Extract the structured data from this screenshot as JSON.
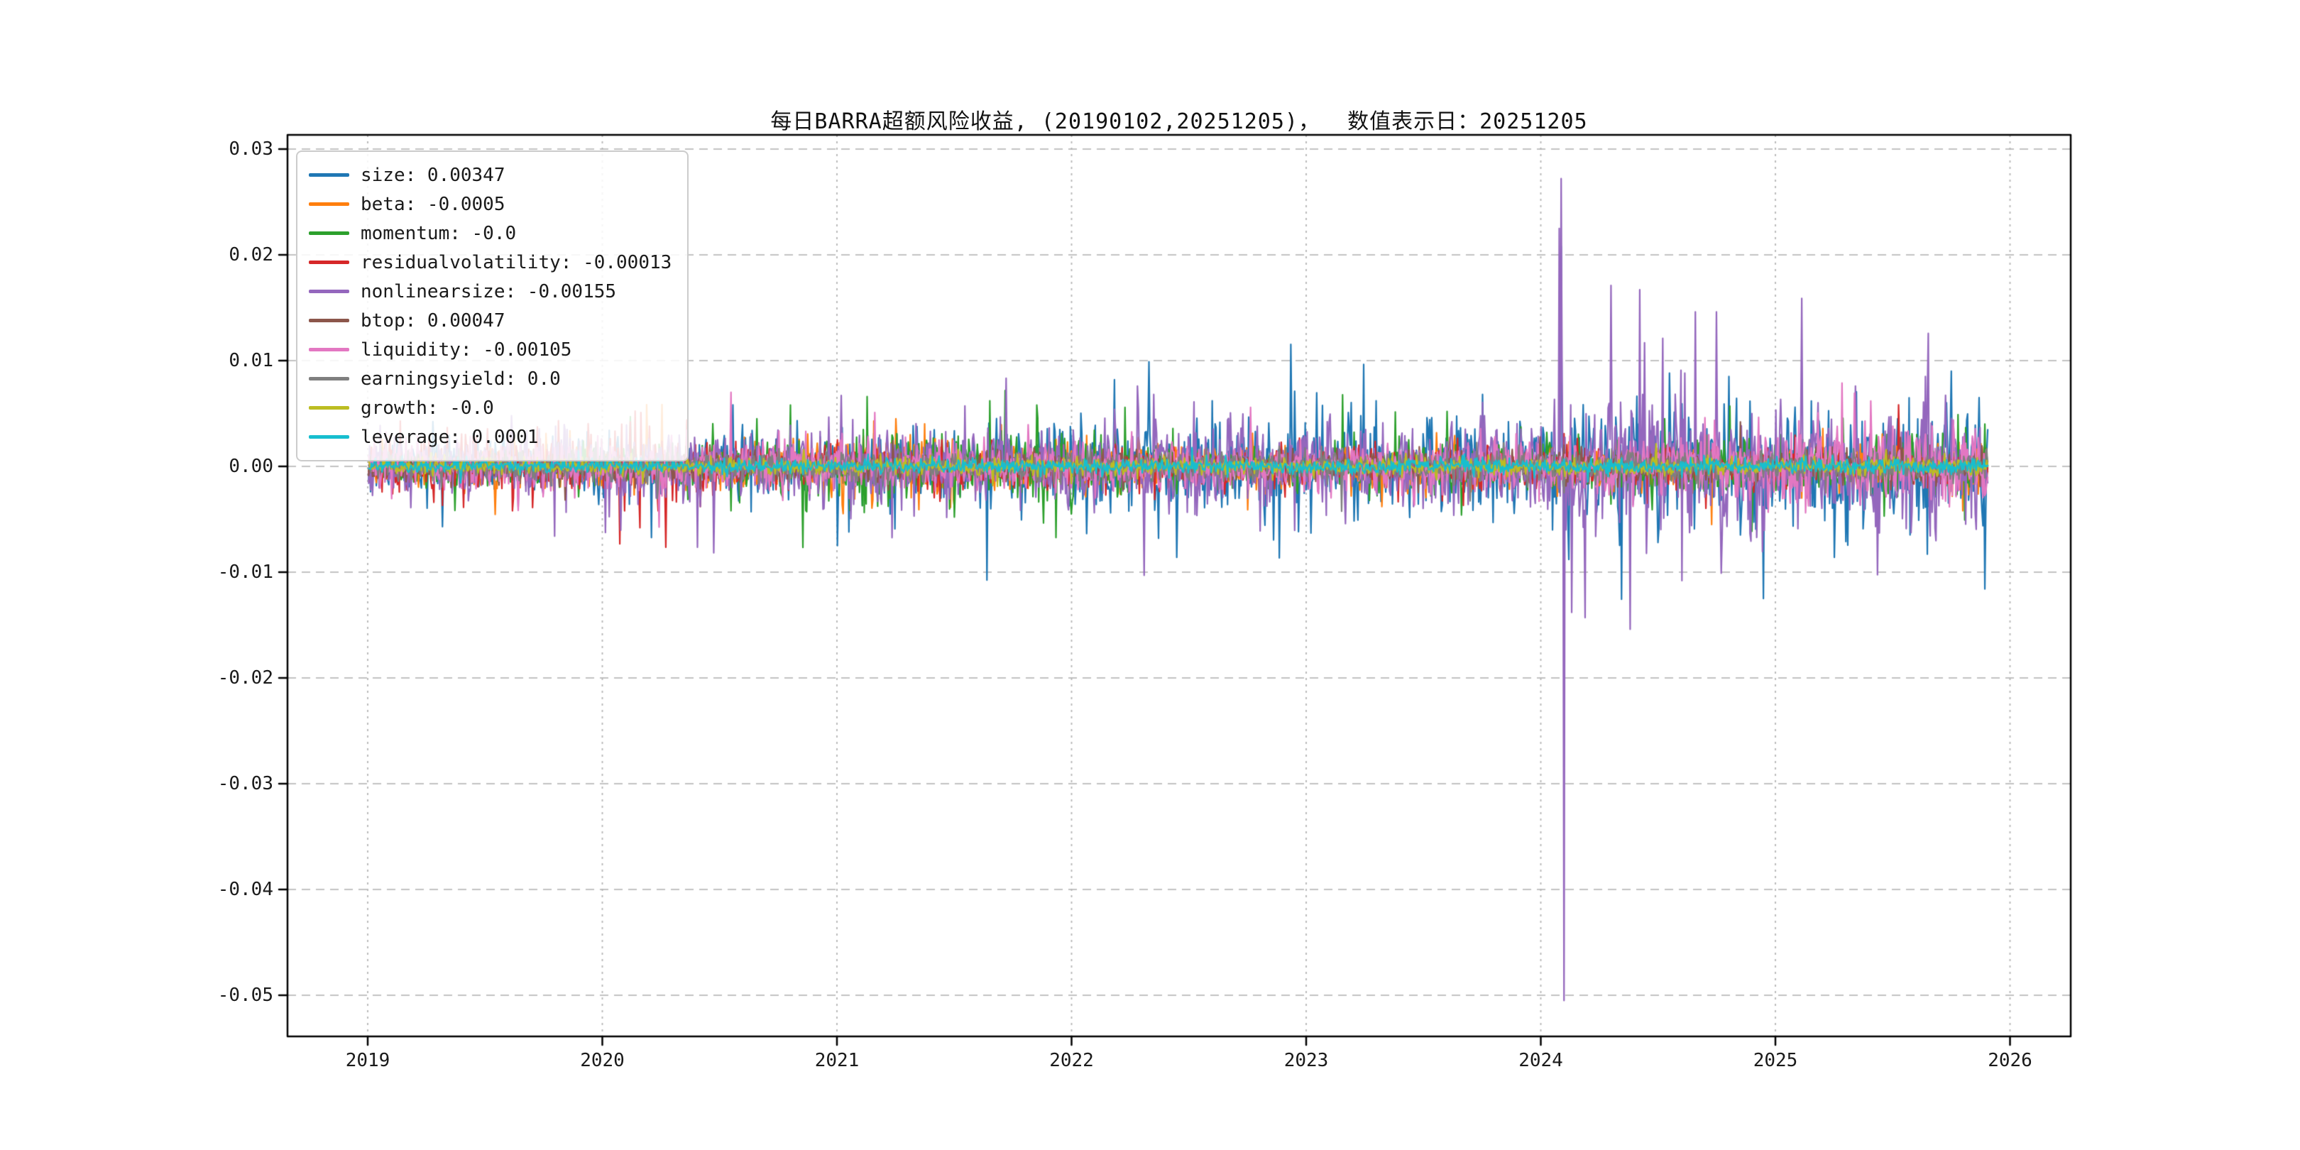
{
  "title": "每日BARRA超额风险收益, (20190102,20251205)，  数值表示日：20251205",
  "chart_data": {
    "type": "line",
    "title": "每日BARRA超额风险收益, (20190102,20251205)，  数值表示日：20251205",
    "date_range_start": "20190102",
    "date_range_end": "20251205",
    "value_label_date": "20251205",
    "xlabel": "",
    "ylabel": "",
    "x_range_years": [
      2019.0,
      2025.92
    ],
    "ylim": [
      -0.054,
      0.031
    ],
    "grid": true,
    "legend_position": "upper left",
    "x_tick_values": [
      2019,
      2020,
      2021,
      2022,
      2023,
      2024,
      2025,
      2026
    ],
    "x_tick_labels": [
      "2019",
      "2020",
      "2021",
      "2022",
      "2023",
      "2024",
      "2025",
      "2026"
    ],
    "y_tick_values": [
      0.03,
      0.02,
      0.01,
      0.0,
      -0.01,
      -0.02,
      -0.03,
      -0.04,
      -0.05
    ],
    "y_tick_labels": [
      "0.03",
      "0.02",
      "0.01",
      "0.00",
      "-0.01",
      "-0.02",
      "-0.03",
      "-0.04",
      "-0.05"
    ],
    "series": [
      {
        "name": "size",
        "legend_label": "size: 0.00347",
        "color": "#1f77b4",
        "last_value": 0.00347,
        "amp_keys": [
          [
            2019,
            0.0013
          ],
          [
            2020,
            0.0013
          ],
          [
            2021,
            0.0015
          ],
          [
            2021.5,
            0.0018
          ],
          [
            2022,
            0.002
          ],
          [
            2022.5,
            0.0022
          ],
          [
            2023,
            0.002
          ],
          [
            2024,
            0.0022
          ],
          [
            2024.3,
            0.0026
          ],
          [
            2025,
            0.0026
          ],
          [
            2025.9,
            0.0028
          ]
        ],
        "spikes": [
          [
            2019.32,
            -0.0057
          ],
          [
            2020.12,
            0.0043
          ],
          [
            2021.0,
            -0.0075
          ],
          [
            2021.05,
            -0.0062
          ],
          [
            2022.33,
            0.0099
          ],
          [
            2022.37,
            -0.0068
          ],
          [
            2022.45,
            -0.0086
          ],
          [
            2022.6,
            0.0062
          ],
          [
            2022.95,
            0.0071
          ],
          [
            2023.02,
            -0.0063
          ],
          [
            2023.3,
            0.0062
          ],
          [
            2023.75,
            0.0068
          ],
          [
            2024.082,
            0.0147
          ],
          [
            2024.088,
            0.0208
          ],
          [
            2024.1,
            -0.0131
          ],
          [
            2024.12,
            -0.0088
          ],
          [
            2024.5,
            -0.0072
          ],
          [
            2024.8,
            0.0085
          ],
          [
            2024.95,
            -0.0125
          ],
          [
            2025.25,
            -0.0086
          ],
          [
            2025.61,
            -0.0051
          ],
          [
            2025.75,
            0.009
          ],
          [
            2025.87,
            0.0065
          ]
        ]
      },
      {
        "name": "beta",
        "legend_label": "beta: -0.0005",
        "color": "#ff7f0e",
        "last_value": -0.0005,
        "amp_keys": [
          [
            2019,
            0.0008
          ],
          [
            2020.1,
            0.0012
          ],
          [
            2020.4,
            0.0008
          ],
          [
            2021.1,
            0.0016
          ],
          [
            2021.7,
            0.0014
          ],
          [
            2022,
            0.001
          ],
          [
            2023,
            0.0008
          ],
          [
            2024,
            0.0009
          ],
          [
            2025,
            0.001
          ],
          [
            2025.9,
            0.0012
          ]
        ],
        "spikes": [
          [
            2020.16,
            -0.0031
          ],
          [
            2021.25,
            0.0045
          ],
          [
            2021.35,
            -0.0041
          ],
          [
            2021.5,
            -0.0038
          ],
          [
            2024.73,
            -0.0055
          ],
          [
            2025.8,
            -0.0042
          ]
        ]
      },
      {
        "name": "momentum",
        "legend_label": "momentum: -0.0",
        "color": "#2ca02c",
        "last_value": 0.0,
        "amp_keys": [
          [
            2019,
            0.0008
          ],
          [
            2020.4,
            0.001
          ],
          [
            2020.9,
            0.0016
          ],
          [
            2021.9,
            0.0016
          ],
          [
            2022.3,
            0.0012
          ],
          [
            2023,
            0.001
          ],
          [
            2023.6,
            0.0014
          ],
          [
            2024,
            0.0012
          ],
          [
            2025,
            0.0012
          ],
          [
            2025.9,
            0.0014
          ]
        ],
        "spikes": [
          [
            2020.12,
            0.0047
          ],
          [
            2020.55,
            -0.0042
          ],
          [
            2020.66,
            0.0045
          ],
          [
            2020.8,
            0.0058
          ],
          [
            2021.13,
            0.0066
          ],
          [
            2021.5,
            -0.0048
          ],
          [
            2021.65,
            0.0062
          ],
          [
            2021.85,
            0.0058
          ],
          [
            2022.0,
            -0.0045
          ],
          [
            2023.6,
            0.0052
          ],
          [
            2023.66,
            -0.0046
          ],
          [
            2024.53,
            0.0045
          ],
          [
            2025.78,
            0.0049
          ]
        ]
      },
      {
        "name": "residualvolatility",
        "legend_label": "residualvolatility: -0.00013",
        "color": "#d62728",
        "last_value": -0.00013,
        "amp_keys": [
          [
            2019,
            0.0014
          ],
          [
            2020.3,
            0.0016
          ],
          [
            2020.8,
            0.001
          ],
          [
            2022,
            0.0009
          ],
          [
            2023,
            0.0008
          ],
          [
            2024,
            0.001
          ],
          [
            2025,
            0.0009
          ],
          [
            2025.9,
            0.001
          ]
        ],
        "spikes": [
          [
            2019.28,
            -0.0034
          ],
          [
            2020.12,
            0.0042
          ],
          [
            2020.16,
            -0.0058
          ],
          [
            2020.2,
            0.0038
          ],
          [
            2024.1,
            0.0031
          ],
          [
            2024.6,
            -0.0035
          ]
        ]
      },
      {
        "name": "nonlinearsize",
        "legend_label": "nonlinearsize: -0.00155",
        "color": "#9467bd",
        "last_value": -0.00155,
        "amp_keys": [
          [
            2019,
            0.0016
          ],
          [
            2020,
            0.0016
          ],
          [
            2021,
            0.0018
          ],
          [
            2022,
            0.002
          ],
          [
            2022.6,
            0.0022
          ],
          [
            2023,
            0.0018
          ],
          [
            2024,
            0.002
          ],
          [
            2024.15,
            0.0035
          ],
          [
            2024.6,
            0.0032
          ],
          [
            2025,
            0.0028
          ],
          [
            2025.9,
            0.0028
          ]
        ],
        "spikes": [
          [
            2019.8,
            0.0038
          ],
          [
            2021.02,
            0.0067
          ],
          [
            2022.28,
            0.0076
          ],
          [
            2022.31,
            -0.0103
          ],
          [
            2022.35,
            0.0068
          ],
          [
            2022.52,
            0.0061
          ],
          [
            2023.1,
            0.0042
          ],
          [
            2024.078,
            0.0225
          ],
          [
            2024.085,
            0.0272
          ],
          [
            2024.092,
            0.008
          ],
          [
            2024.1,
            -0.0505
          ],
          [
            2024.107,
            -0.006
          ],
          [
            2024.13,
            -0.0138
          ],
          [
            2024.19,
            -0.0143
          ],
          [
            2024.3,
            0.0171
          ],
          [
            2024.38,
            -0.0154
          ],
          [
            2024.42,
            0.0167
          ],
          [
            2024.52,
            0.0121
          ],
          [
            2024.6,
            -0.0108
          ],
          [
            2024.75,
            0.0146
          ],
          [
            2024.77,
            -0.0101
          ],
          [
            2025.34,
            0.0076
          ],
          [
            2025.64,
            0.0085
          ]
        ]
      },
      {
        "name": "btop",
        "legend_label": "btop: 0.00047",
        "color": "#8c564b",
        "last_value": 0.00047,
        "amp_keys": [
          [
            2019,
            0.0006
          ],
          [
            2025.9,
            0.0007
          ]
        ],
        "spikes": [
          [
            2024.1,
            0.002
          ]
        ]
      },
      {
        "name": "liquidity",
        "legend_label": "liquidity: -0.00105",
        "color": "#e377c2",
        "last_value": -0.00105,
        "amp_keys": [
          [
            2019,
            0.0011
          ],
          [
            2020,
            0.0012
          ],
          [
            2021,
            0.001
          ],
          [
            2022,
            0.0011
          ],
          [
            2023,
            0.001
          ],
          [
            2024,
            0.0012
          ],
          [
            2024.5,
            0.0016
          ],
          [
            2025,
            0.0017
          ],
          [
            2025.9,
            0.0018
          ]
        ],
        "spikes": [
          [
            2020.55,
            0.007
          ],
          [
            2024.7,
            0.0046
          ],
          [
            2025.1,
            0.0043
          ],
          [
            2025.5,
            0.0038
          ]
        ]
      },
      {
        "name": "earningsyield",
        "legend_label": "earningsyield: 0.0",
        "color": "#7f7f7f",
        "last_value": 0.0,
        "amp_keys": [
          [
            2019,
            0.0006
          ],
          [
            2025.9,
            0.0007
          ]
        ],
        "spikes": [
          [
            2020.3,
            0.0022
          ],
          [
            2024.1,
            -0.0025
          ]
        ]
      },
      {
        "name": "growth",
        "legend_label": "growth: -0.0",
        "color": "#bcbd22",
        "last_value": 0.0,
        "amp_keys": [
          [
            2019,
            0.00035
          ],
          [
            2025.9,
            0.0004
          ]
        ],
        "spikes": []
      },
      {
        "name": "leverage",
        "legend_label": "leverage: 0.0001",
        "color": "#17becf",
        "last_value": 0.0001,
        "amp_keys": [
          [
            2019,
            0.0003
          ],
          [
            2025.9,
            0.00035
          ]
        ],
        "spikes": []
      }
    ]
  }
}
